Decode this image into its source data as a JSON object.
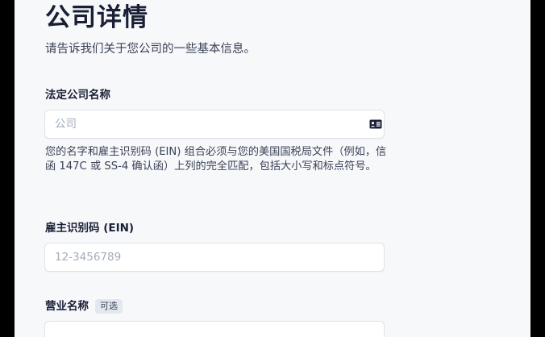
{
  "header": {
    "title": "公司详情",
    "subtitle": "请告诉我们关于您公司的一些基本信息。"
  },
  "fields": {
    "legal_name": {
      "label": "法定公司名称",
      "placeholder": "公司",
      "icon": "contact-card-icon",
      "help": "您的名字和雇主识别码 (EIN) 组合必须与您的美国国税局文件（例如，信函 147C 或 SS-4 确认函）上列的完全匹配，包括大小写和标点符号。"
    },
    "ein": {
      "label": "雇主识别码 (EIN)",
      "placeholder": "12-3456789"
    },
    "business_name": {
      "label": "营业名称",
      "optional_badge": "可选"
    }
  },
  "colors": {
    "background": "#f6f8fa",
    "text_primary": "#1a1f36",
    "text_secondary": "#3c4257",
    "placeholder": "#a3acb9",
    "border": "#dfe3e8"
  }
}
